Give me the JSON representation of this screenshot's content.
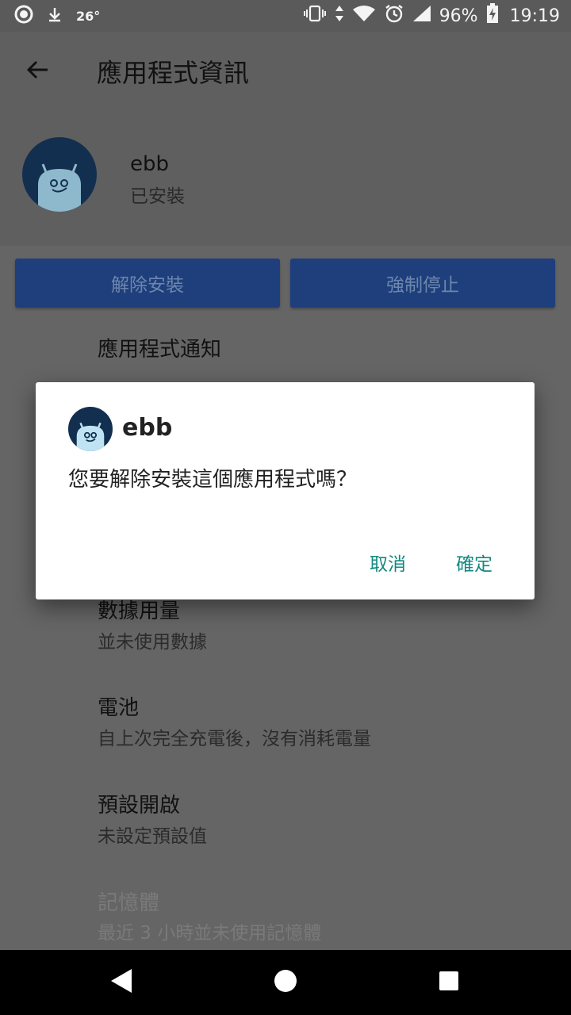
{
  "status_bar": {
    "temperature": "26°",
    "battery_percent": "96%",
    "time": "19:19",
    "icons": [
      "notification-circle-icon",
      "download-arrow-icon",
      "vibrate-icon",
      "data-arrows-icon",
      "wifi-icon",
      "alarm-icon",
      "signal-icon",
      "battery-charging-icon"
    ]
  },
  "app_bar": {
    "title": "應用程式資訊",
    "back_icon": "arrow-back-icon"
  },
  "app": {
    "name": "ebb",
    "status": "已安裝"
  },
  "actions": {
    "uninstall": "解除安裝",
    "force_stop": "強制停止"
  },
  "list": {
    "notifications": {
      "title": "應用程式通知"
    },
    "data_usage": {
      "title": "數據用量",
      "subtitle": "並未使用數據"
    },
    "battery": {
      "title": "電池",
      "subtitle": "自上次完全充電後，沒有消耗電量"
    },
    "open_by_default": {
      "title": "預設開啟",
      "subtitle": "未設定預設值"
    },
    "memory": {
      "title": "記憶體",
      "subtitle": "最近 3 小時並未使用記憶體"
    }
  },
  "dialog": {
    "title": "ebb",
    "message": "您要解除安裝這個應用程式嗎？",
    "cancel": "取消",
    "confirm": "確定"
  },
  "colors": {
    "dialog_button": "#12897f",
    "disabled_button_bg": "#1e3f7c",
    "app_icon_bg": "#132f4f"
  },
  "nav_bar": {
    "icons": [
      "nav-back-icon",
      "nav-home-icon",
      "nav-recents-icon"
    ]
  }
}
